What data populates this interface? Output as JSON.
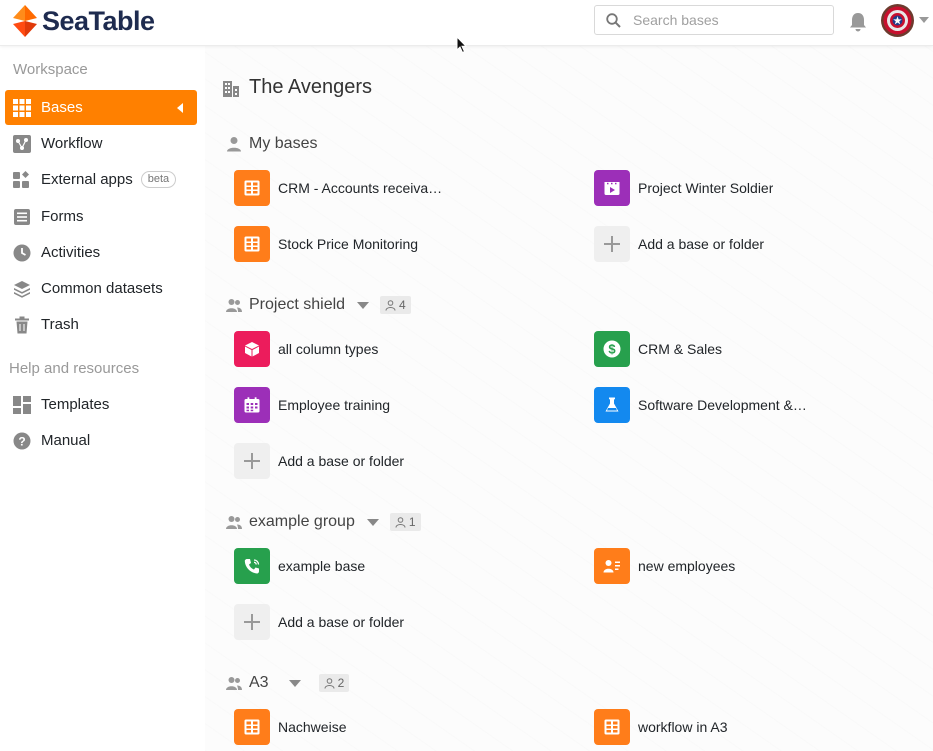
{
  "app": {
    "logo_text": "SeaTable"
  },
  "search": {
    "placeholder": "Search bases"
  },
  "sidebar": {
    "workspace_label": "Workspace",
    "items": [
      {
        "label": "Bases"
      },
      {
        "label": "Workflow"
      },
      {
        "label": "External apps",
        "badge": "beta"
      },
      {
        "label": "Forms"
      },
      {
        "label": "Activities"
      },
      {
        "label": "Common datasets"
      },
      {
        "label": "Trash"
      }
    ],
    "help_label": "Help and resources",
    "help_items": [
      {
        "label": "Templates"
      },
      {
        "label": "Manual"
      }
    ]
  },
  "main": {
    "workspace_title": "The Avengers",
    "my_bases": {
      "title": "My bases",
      "bases": [
        {
          "name": "CRM - Accounts receiva…",
          "color": "#ff7d1a",
          "icon": "table-icon"
        },
        {
          "name": "Project Winter Soldier",
          "color": "#9c2fb8",
          "icon": "video-icon"
        },
        {
          "name": "Stock Price Monitoring",
          "color": "#ff7d1a",
          "icon": "table-icon"
        },
        {
          "name": "Add a base or folder",
          "icon": "plus-icon"
        }
      ]
    },
    "groups": [
      {
        "title": "Project shield",
        "members": "4",
        "bases": [
          {
            "name": "all column types",
            "color": "#ec1c5c",
            "icon": "cube-icon"
          },
          {
            "name": "CRM & Sales",
            "color": "#27a04d",
            "icon": "dollar-icon"
          },
          {
            "name": "Employee training",
            "color": "#9c2fb8",
            "icon": "calendar-icon"
          },
          {
            "name": "Software Development &…",
            "color": "#1389ef",
            "icon": "flask-icon"
          },
          {
            "name": "Add a base or folder",
            "icon": "plus-icon"
          }
        ]
      },
      {
        "title": "example group",
        "members": "1",
        "bases": [
          {
            "name": "example base",
            "color": "#27a04d",
            "icon": "phone-icon"
          },
          {
            "name": "new employees",
            "color": "#ff7d1a",
            "icon": "contact-icon"
          },
          {
            "name": "Add a base or folder",
            "icon": "plus-icon"
          }
        ]
      },
      {
        "title": "A3",
        "members": "2",
        "bases": [
          {
            "name": "Nachweise",
            "color": "#ff7d1a",
            "icon": "table-icon"
          },
          {
            "name": "workflow in A3",
            "color": "#ff7d1a",
            "icon": "table-icon"
          }
        ]
      }
    ]
  }
}
